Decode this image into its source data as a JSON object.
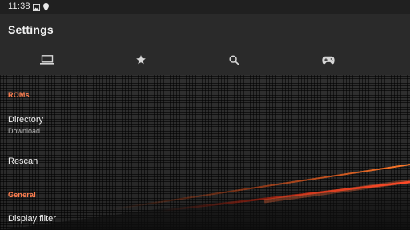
{
  "status_bar": {
    "time": "11:38",
    "icons": [
      "image-icon",
      "location-pin-icon"
    ]
  },
  "app_bar": {
    "title": "Settings"
  },
  "tabs": [
    {
      "icon": "laptop-icon",
      "selected": true
    },
    {
      "icon": "star-icon",
      "selected": false
    },
    {
      "icon": "search-icon",
      "selected": false
    },
    {
      "icon": "gamepad-icon",
      "selected": false
    }
  ],
  "sections": [
    {
      "header": "ROMs",
      "items": [
        {
          "title": "Directory",
          "summary": "Download"
        },
        {
          "title": "Rescan"
        }
      ]
    },
    {
      "header": "General",
      "items": [
        {
          "title": "Display filter"
        }
      ]
    }
  ],
  "colors": {
    "accent": "#ff7f50",
    "bar_background": "#2a2a2a",
    "status_background": "#202020"
  }
}
